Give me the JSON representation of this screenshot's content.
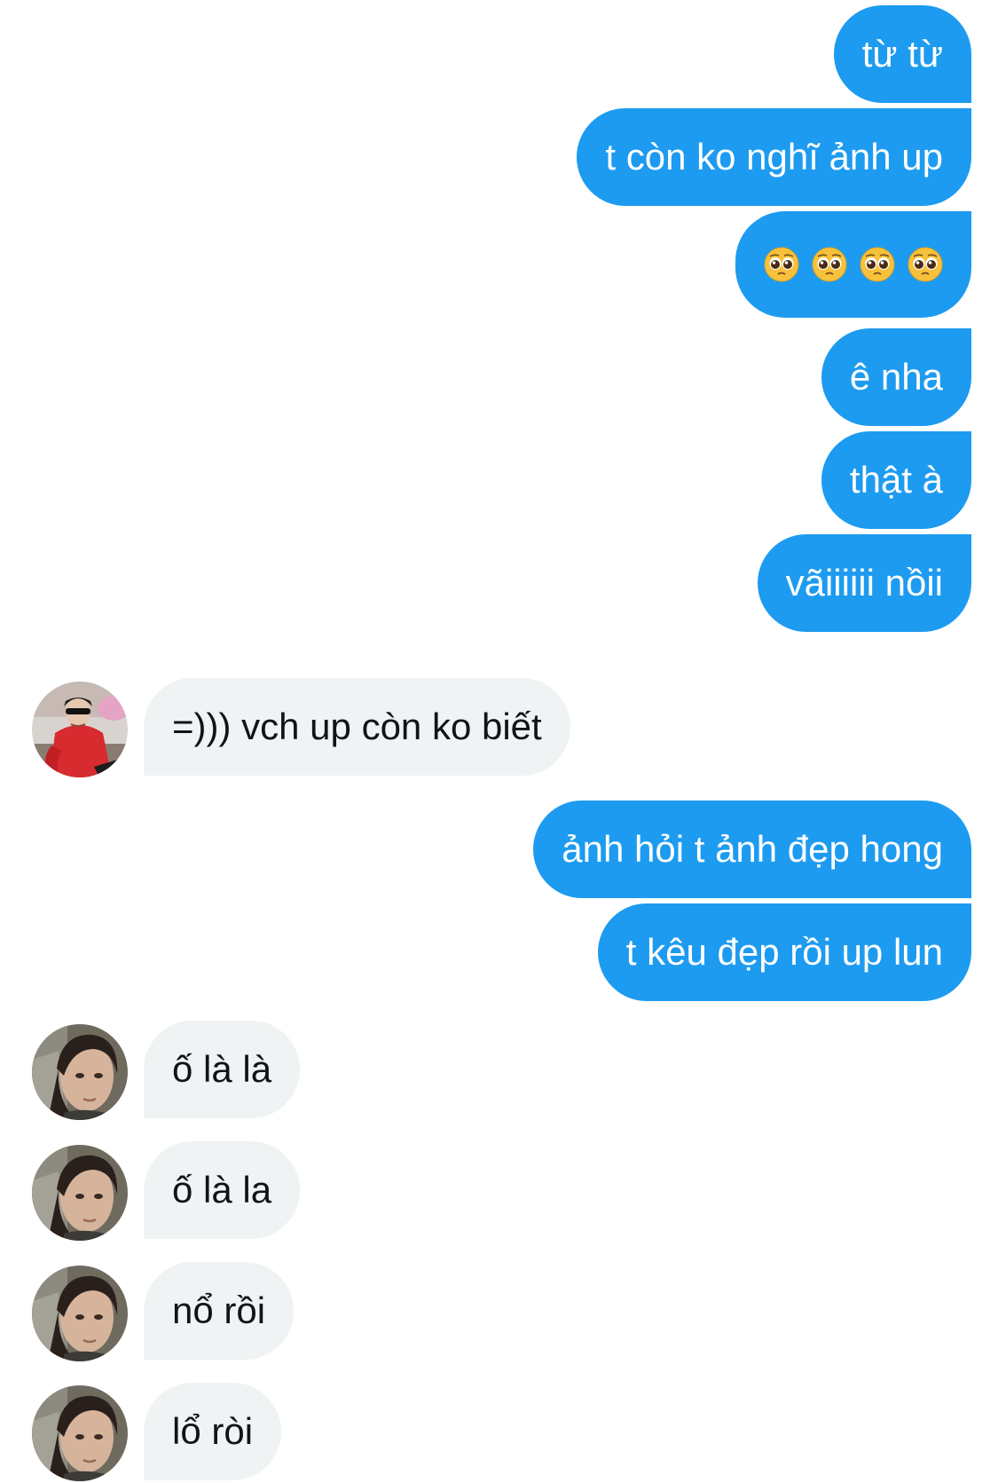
{
  "colors": {
    "outgoing_bubble": "#1d9bf0",
    "incoming_bubble": "#eff3f4",
    "outgoing_text": "#ffffff",
    "incoming_text": "#0f1419"
  },
  "messages": [
    {
      "direction": "outgoing",
      "text": "từ từ"
    },
    {
      "direction": "outgoing",
      "text": "t còn ko nghĩ ảnh up"
    },
    {
      "direction": "outgoing",
      "emoji": [
        "pleading-face",
        "pleading-face",
        "pleading-face",
        "pleading-face"
      ]
    },
    {
      "direction": "outgoing",
      "text": "ê nha"
    },
    {
      "direction": "outgoing",
      "text": "thật à"
    },
    {
      "direction": "outgoing",
      "text": "vãiiiiii nồii"
    },
    {
      "direction": "incoming",
      "avatar": "red-jacket-sunglasses-avatar",
      "text": "=))) vch up còn ko biết"
    },
    {
      "direction": "outgoing",
      "text": "ảnh hỏi t ảnh đẹp hong"
    },
    {
      "direction": "outgoing",
      "text": "t kêu đẹp rồi up lun"
    },
    {
      "direction": "incoming",
      "avatar": "selfie-avatar",
      "text": "ố là là"
    },
    {
      "direction": "incoming",
      "avatar": "selfie-avatar",
      "text": "ố là la"
    },
    {
      "direction": "incoming",
      "avatar": "selfie-avatar",
      "text": "nổ rồi"
    },
    {
      "direction": "incoming",
      "avatar": "selfie-avatar",
      "text": "lổ ròi"
    }
  ]
}
